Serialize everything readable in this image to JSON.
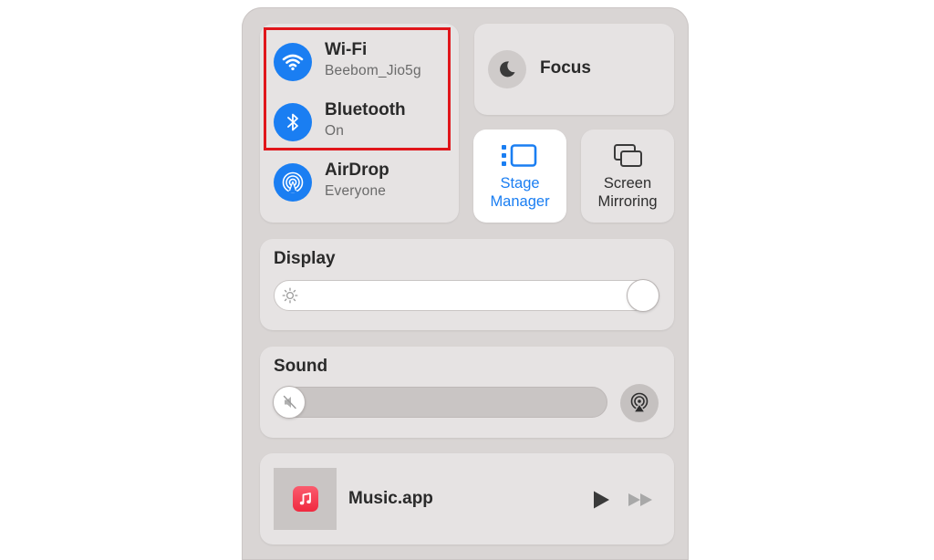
{
  "connectivity": {
    "wifi": {
      "title": "Wi-Fi",
      "subtitle": "Beebom_Jio5g",
      "icon": "wifi-icon"
    },
    "bluetooth": {
      "title": "Bluetooth",
      "subtitle": "On",
      "icon": "bluetooth-icon"
    },
    "airdrop": {
      "title": "AirDrop",
      "subtitle": "Everyone",
      "icon": "airdrop-icon"
    },
    "active_color": "#1a7ef2"
  },
  "focus": {
    "label": "Focus",
    "icon": "moon-icon"
  },
  "stage_manager": {
    "line1": "Stage",
    "line2": "Manager",
    "icon": "stage-manager-icon",
    "active": true
  },
  "screen_mirroring": {
    "line1": "Screen",
    "line2": "Mirroring",
    "icon": "screen-mirroring-icon"
  },
  "display": {
    "title": "Display",
    "brightness": 1.0,
    "icon": "sun-icon"
  },
  "sound": {
    "title": "Sound",
    "volume": 0.0,
    "icon": "speaker-muted-icon",
    "output_icon": "airplay-audio-icon"
  },
  "now_playing": {
    "app": "Music.app",
    "app_icon": "music-note-icon",
    "controls": [
      "play-icon",
      "fast-forward-icon"
    ]
  },
  "annotation": {
    "color": "#e0161b"
  }
}
